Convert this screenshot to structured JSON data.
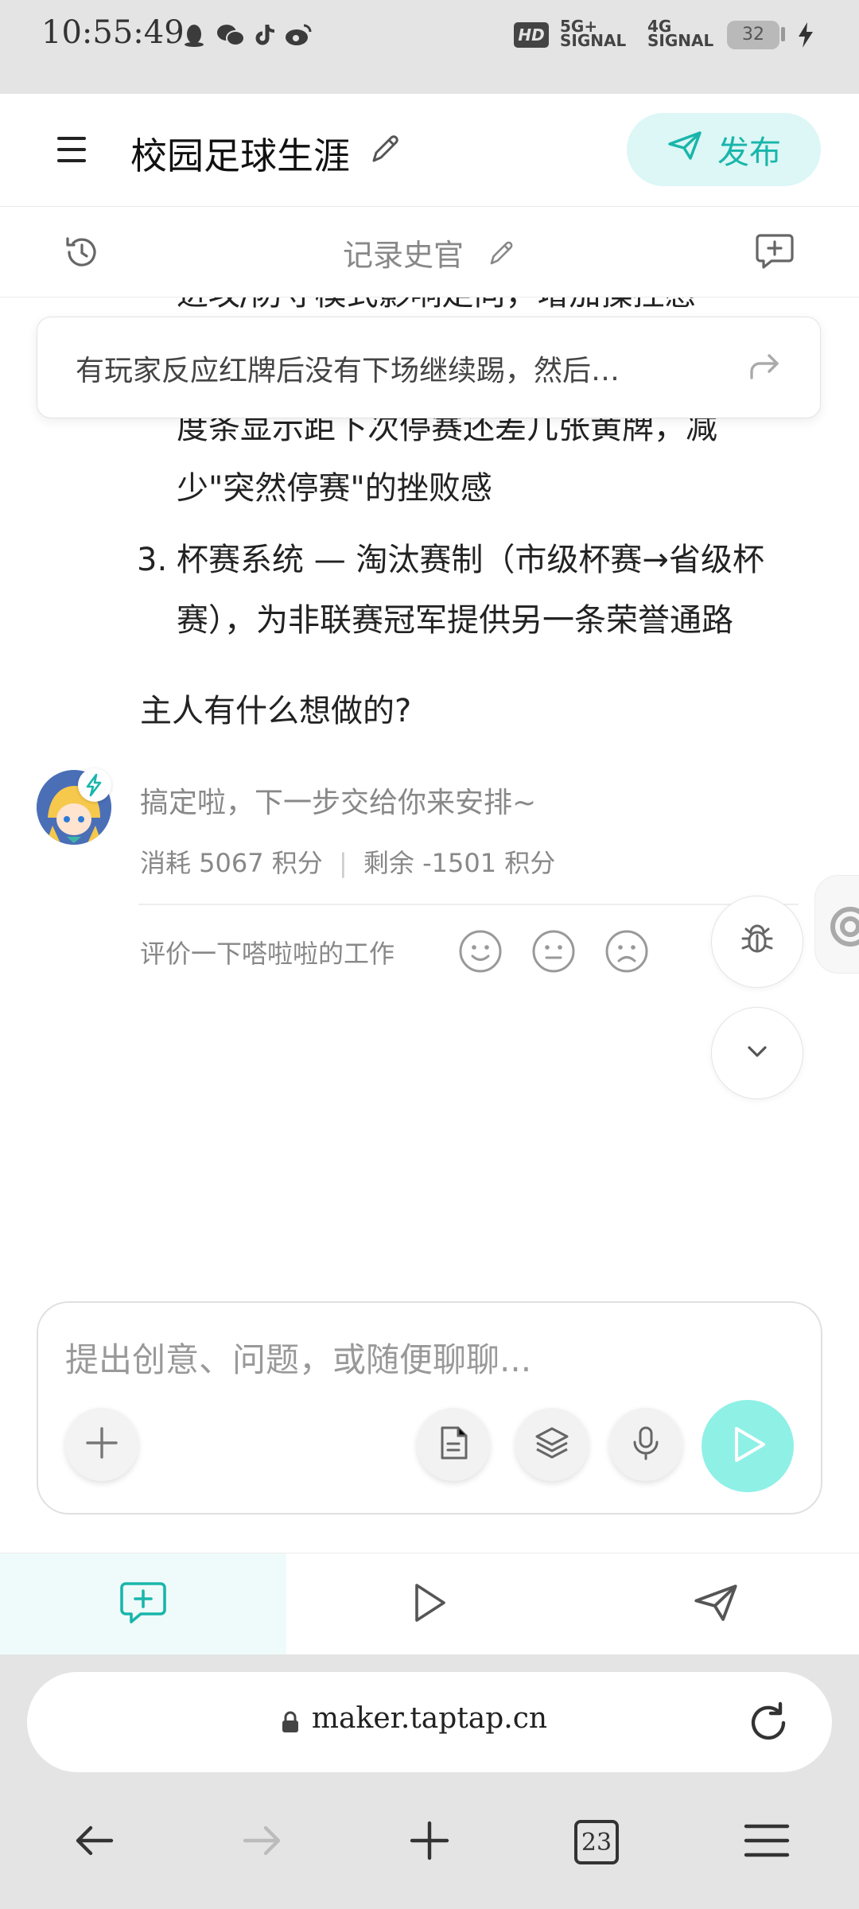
{
  "status_bar": {
    "time": "10:55:49",
    "hd": "HD",
    "net1_top": "5G+",
    "net1_bottom": "SIGNAL",
    "net2_top": "4G",
    "net2_bottom": "SIGNAL",
    "battery": "32"
  },
  "header": {
    "project_title": "校园足球生涯",
    "publish_label": "发布"
  },
  "subheader": {
    "title": "记录史官"
  },
  "chat": {
    "line_partial_top": "进攻/防守模式影响走向，增加操控感",
    "quote_text": "有玩家反应红牌后没有下场继续踢，然后…",
    "line_a": "度条显示距下次停赛还差几张黄牌，减",
    "line_b": "少\"突然停赛\"的挫败感",
    "item3_num": "3.",
    "item3_line1": "杯赛系统 — 淘汰赛制（市级杯赛→省级杯",
    "item3_line2": "赛），为非联赛冠军提供另一条荣誉通路",
    "question": "主人有什么想做的?",
    "done_msg": "搞定啦，下一步交给你来安排~",
    "cost": "消耗 5067 积分",
    "separator": "|",
    "remaining": "剩余 -1501 积分",
    "rate_prompt": "评价一下嗒啦啦的工作"
  },
  "input": {
    "placeholder": "提出创意、问题，或随便聊聊..."
  },
  "browser": {
    "url": "maker.taptap.cn",
    "tab_count": "23"
  },
  "colors": {
    "accent": "#19b5ab",
    "accent_light": "#dcf7f5",
    "send_button": "#8ff0e6"
  }
}
